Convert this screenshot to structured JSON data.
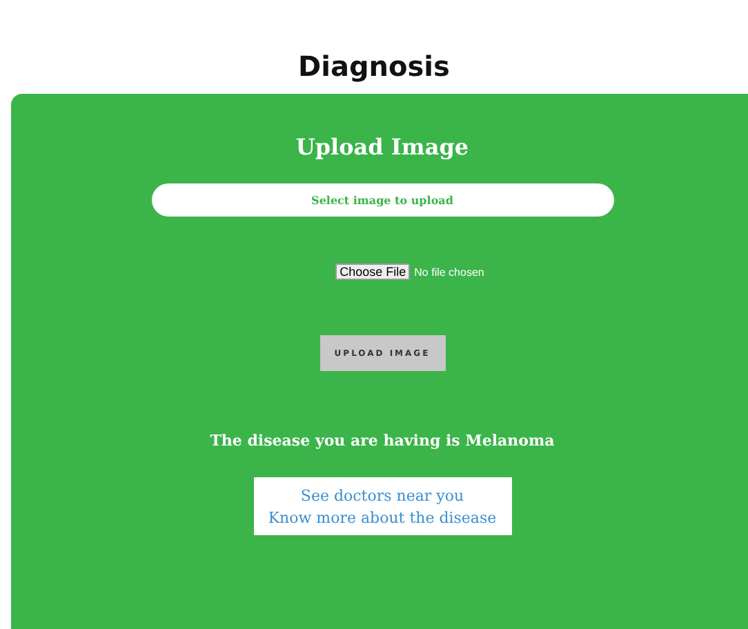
{
  "page_title": "Diagnosis",
  "panel": {
    "heading": "Upload Image",
    "field": {
      "placeholder": "Select image to upload"
    },
    "file_input": {
      "button": "Choose File",
      "status": "No file chosen"
    },
    "upload_button": "UPLOAD IMAGE",
    "result": "The disease you are having is Melanoma",
    "links": [
      "See doctors near you",
      "Know more about the disease"
    ]
  }
}
